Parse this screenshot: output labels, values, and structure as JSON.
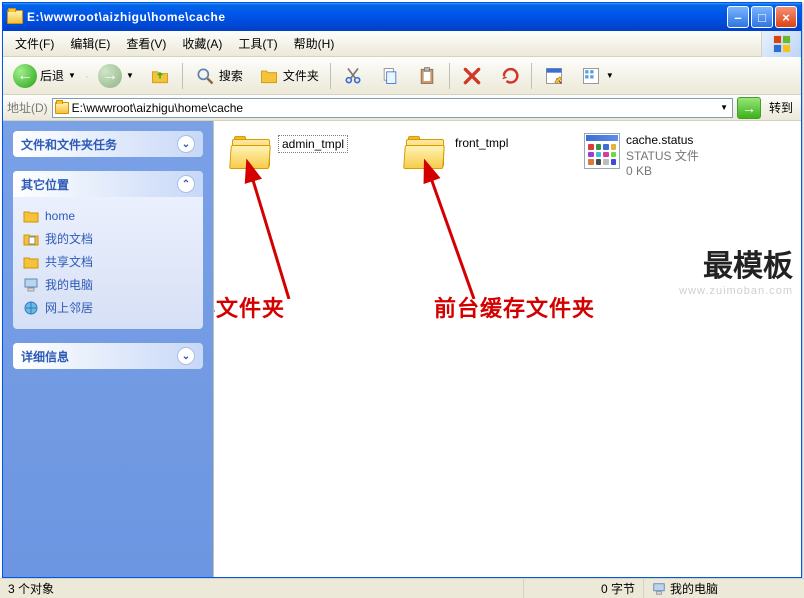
{
  "window": {
    "title": "E:\\wwwroot\\aizhigu\\home\\cache"
  },
  "menu": {
    "file": "文件(F)",
    "edit": "编辑(E)",
    "view": "查看(V)",
    "fav": "收藏(A)",
    "tools": "工具(T)",
    "help": "帮助(H)"
  },
  "toolbar": {
    "back": "后退",
    "search": "搜索",
    "folders": "文件夹"
  },
  "address": {
    "label": "地址(D)",
    "path": "E:\\wwwroot\\aizhigu\\home\\cache",
    "go": "转到"
  },
  "panels": {
    "tasks": {
      "title": "文件和文件夹任务"
    },
    "other": {
      "title": "其它位置",
      "items": [
        {
          "label": "home"
        },
        {
          "label": "我的文档"
        },
        {
          "label": "共享文档"
        },
        {
          "label": "我的电脑"
        },
        {
          "label": "网上邻居"
        }
      ]
    },
    "details": {
      "title": "详细信息"
    }
  },
  "files": {
    "folder1": "admin_tmpl",
    "folder2": "front_tmpl",
    "status": {
      "name": "cache.status",
      "type": "STATUS 文件",
      "size": "0 KB"
    }
  },
  "annotations": {
    "left": "后台缓存文件夹",
    "right": "前台缓存文件夹",
    "watermark": "最模板",
    "watermark_url": "www.zuimoban.com"
  },
  "status": {
    "objects": "3 个对象",
    "bytes": "0 字节",
    "loc": "我的电脑"
  }
}
